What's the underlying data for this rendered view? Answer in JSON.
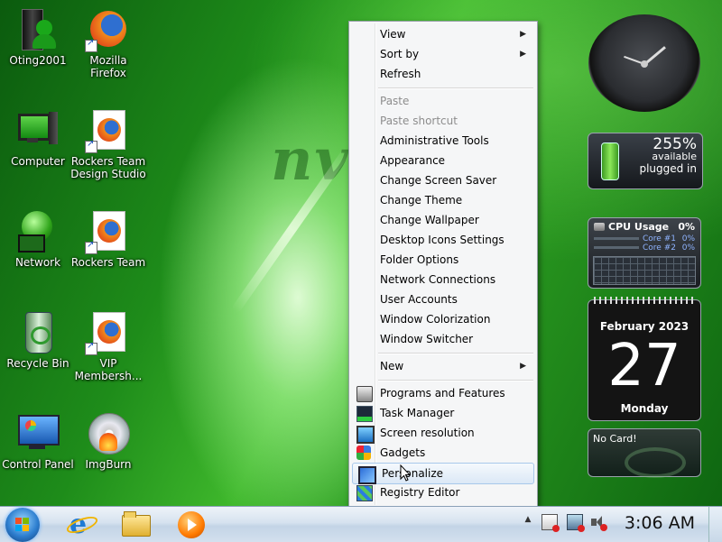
{
  "wallpaper": {
    "watermark": "nv"
  },
  "desktop_icons": [
    {
      "name": "user-folder",
      "label": "Oting2001",
      "icon": "user-icon"
    },
    {
      "name": "firefox",
      "label": "Mozilla Firefox",
      "icon": "firefox-icon"
    },
    {
      "name": "computer",
      "label": "Computer",
      "icon": "computer-icon"
    },
    {
      "name": "rockers-design",
      "label": "Rockers Team Design Studio",
      "icon": "firefox-page-icon"
    },
    {
      "name": "network",
      "label": "Network",
      "icon": "network-icon"
    },
    {
      "name": "rockers-team",
      "label": "Rockers Team",
      "icon": "firefox-page-icon"
    },
    {
      "name": "recycle-bin",
      "label": "Recycle Bin",
      "icon": "recycle-bin-icon"
    },
    {
      "name": "vip",
      "label": "VIP Membersh...",
      "icon": "firefox-page-icon"
    },
    {
      "name": "control-panel",
      "label": "Control Panel",
      "icon": "control-panel-icon"
    },
    {
      "name": "imgburn",
      "label": "ImgBurn",
      "icon": "disc-icon"
    }
  ],
  "context_menu": {
    "items": [
      {
        "label": "View",
        "submenu": true
      },
      {
        "label": "Sort by",
        "submenu": true
      },
      {
        "label": "Refresh"
      },
      {
        "label": "Paste",
        "disabled": true
      },
      {
        "label": "Paste shortcut",
        "disabled": true
      },
      {
        "label": "Administrative Tools"
      },
      {
        "label": "Appearance"
      },
      {
        "label": "Change Screen Saver"
      },
      {
        "label": "Change Theme"
      },
      {
        "label": "Change Wallpaper"
      },
      {
        "label": "Desktop Icons Settings"
      },
      {
        "label": "Folder Options"
      },
      {
        "label": "Network Connections"
      },
      {
        "label": "User Accounts"
      },
      {
        "label": "Window Colorization"
      },
      {
        "label": "Window Switcher"
      },
      {
        "label": "New",
        "submenu": true
      },
      {
        "label": "Programs and Features",
        "icon": "programs-icon"
      },
      {
        "label": "Task Manager",
        "icon": "task-manager-icon"
      },
      {
        "label": "Screen resolution",
        "icon": "screen-resolution-icon"
      },
      {
        "label": "Gadgets",
        "icon": "gadgets-icon"
      },
      {
        "label": "Personalize",
        "icon": "personalize-icon",
        "highlighted": true
      },
      {
        "label": "Registry Editor",
        "icon": "registry-editor-icon"
      }
    ]
  },
  "gadgets": {
    "battery": {
      "percent": "255%",
      "status": "available",
      "power": "plugged in"
    },
    "cpu": {
      "title": "CPU Usage",
      "total": "0%",
      "core1_label": "Core #1",
      "core1_value": "0%",
      "core2_label": "Core #2",
      "core2_value": "0%"
    },
    "calendar": {
      "month": "February 2023",
      "day": "27",
      "weekday": "Monday"
    },
    "gpu": {
      "status": "No Card!"
    }
  },
  "taskbar": {
    "pinned": [
      "internet-explorer-icon",
      "windows-explorer-icon",
      "media-player-icon"
    ],
    "tray_icons": [
      "show-hidden-icons-icon",
      "action-center-icon",
      "network-tray-icon",
      "volume-muted-icon"
    ],
    "clock": "3:06 AM"
  },
  "colors": {
    "menu_bg": "#f5f6f7",
    "highlight_border": "#a8c8eb",
    "wallpaper_green": "#2a9a20"
  }
}
